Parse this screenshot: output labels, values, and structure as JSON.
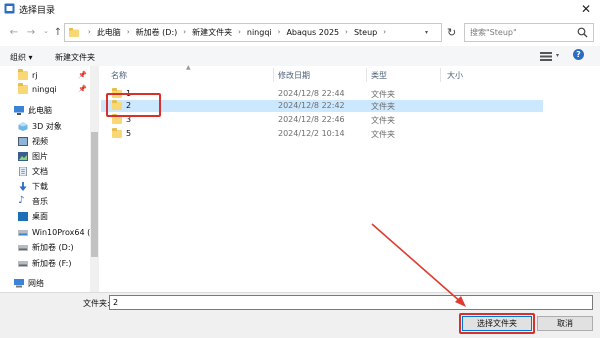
{
  "window": {
    "title": "选择目录"
  },
  "address": {
    "crumbs": [
      "此电脑",
      "新加卷 (D:)",
      "新建文件夹",
      "ningqi",
      "Abaqus 2025",
      "Steup"
    ]
  },
  "search": {
    "placeholder": "搜索\"Steup\""
  },
  "toolbar": {
    "organize": "组织 ▾",
    "new_folder": "新建文件夹"
  },
  "nav": {
    "items": [
      {
        "label": "rj",
        "icon": "folder-icon",
        "pinned": true
      },
      {
        "label": "ningqi",
        "icon": "folder-icon",
        "pinned": true
      },
      {
        "label": "此电脑",
        "icon": "computer-icon"
      },
      {
        "label": "3D 对象",
        "icon": "3d-objects-icon"
      },
      {
        "label": "视频",
        "icon": "video-icon"
      },
      {
        "label": "图片",
        "icon": "pictures-icon"
      },
      {
        "label": "文档",
        "icon": "documents-icon"
      },
      {
        "label": "下载",
        "icon": "download-icon"
      },
      {
        "label": "音乐",
        "icon": "music-icon"
      },
      {
        "label": "桌面",
        "icon": "desktop-icon"
      },
      {
        "label": "Win10Prox64 (C",
        "icon": "drive-icon"
      },
      {
        "label": "新加卷 (D:)",
        "icon": "drive-icon"
      },
      {
        "label": "新加卷 (F:)",
        "icon": "drive-icon"
      },
      {
        "label": "网络",
        "icon": "network-icon"
      }
    ]
  },
  "columns": {
    "name": "名称",
    "date": "修改日期",
    "type": "类型",
    "size": "大小"
  },
  "files": [
    {
      "name": "1",
      "date": "2024/12/8 22:44",
      "type": "文件夹"
    },
    {
      "name": "2",
      "date": "2024/12/8 22:42",
      "type": "文件夹",
      "selected": true
    },
    {
      "name": "3",
      "date": "2024/12/8 22:46",
      "type": "文件夹"
    },
    {
      "name": "5",
      "date": "2024/12/2 10:14",
      "type": "文件夹"
    }
  ],
  "footer": {
    "folder_label": "文件夹:",
    "folder_value": "2",
    "select_button": "选择文件夹",
    "cancel_button": "取消"
  },
  "colors": {
    "selection": "#cce8ff",
    "highlight": "#d9302c",
    "accent": "#0078d7"
  }
}
